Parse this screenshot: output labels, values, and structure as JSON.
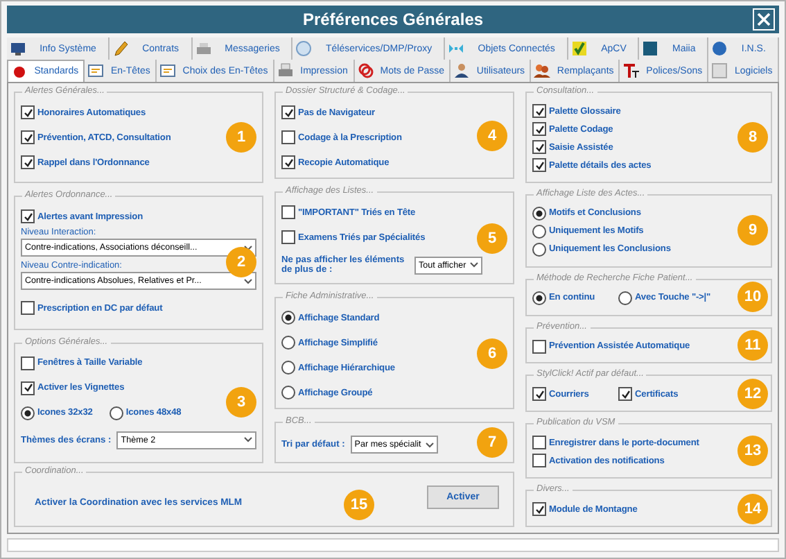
{
  "window": {
    "title": "Préférences Générales"
  },
  "tab_rows": [
    [
      {
        "label": "Info Système",
        "selected": false
      },
      {
        "label": "Contrats",
        "selected": false
      },
      {
        "label": "Messageries",
        "selected": false
      },
      {
        "label": "Téléservices/DMP/Proxy",
        "selected": false
      },
      {
        "label": "Objets Connectés",
        "selected": false
      },
      {
        "label": "ApCV",
        "selected": false
      },
      {
        "label": "Maiia",
        "selected": false
      },
      {
        "label": "I.N.S.",
        "selected": false
      }
    ],
    [
      {
        "label": "Standards",
        "selected": true
      },
      {
        "label": "En-Têtes",
        "selected": false
      },
      {
        "label": "Choix des En-Têtes",
        "selected": false
      },
      {
        "label": "Impression",
        "selected": false
      },
      {
        "label": "Mots de Passe",
        "selected": false
      },
      {
        "label": "Utilisateurs",
        "selected": false
      },
      {
        "label": "Remplaçants",
        "selected": false
      },
      {
        "label": "Polices/Sons",
        "selected": false
      },
      {
        "label": "Logiciels",
        "selected": false
      }
    ]
  ],
  "columns": [
    [
      {
        "title": "Alertes Générales...",
        "badge": "1",
        "items": [
          {
            "kind": "checkbox",
            "label": "Honoraires Automatiques",
            "checked": true
          },
          {
            "kind": "checkbox",
            "label": "Prévention, ATCD, Consultation",
            "checked": true
          },
          {
            "kind": "checkbox",
            "label": "Rappel dans l'Ordonnance",
            "checked": true
          }
        ]
      },
      {
        "title": "Alertes Ordonnance...",
        "badge": "2",
        "items": [
          {
            "kind": "checkbox",
            "label": "Alertes avant Impression",
            "checked": true
          },
          {
            "kind": "caption",
            "text": "Niveau Interaction:"
          },
          {
            "kind": "select",
            "value": "Contre-indications, Associations déconseill..."
          },
          {
            "kind": "caption",
            "text": "Niveau Contre-indication:"
          },
          {
            "kind": "select",
            "value": "Contre-indications Absolues, Relatives et Pr..."
          },
          {
            "kind": "checkbox",
            "label": "Prescription en DC par défaut",
            "checked": false
          }
        ]
      },
      {
        "title": "Options Générales...",
        "badge": "3",
        "items": [
          {
            "kind": "checkbox",
            "label": "Fenêtres à Taille Variable",
            "checked": false
          },
          {
            "kind": "checkbox",
            "label": "Activer les Vignettes",
            "checked": true
          },
          {
            "kind": "row",
            "items": [
              {
                "kind": "radio",
                "label": "Icones 32x32",
                "selected": true
              },
              {
                "kind": "radio",
                "label": "Icones 48x48",
                "selected": false
              }
            ]
          },
          {
            "kind": "select",
            "label": "Thèmes des écrans :",
            "value": "Thème 2"
          }
        ]
      }
    ],
    [
      {
        "title": "Dossier Structuré & Codage...",
        "badge": "4",
        "items": [
          {
            "kind": "checkbox",
            "label": "Pas de Navigateur",
            "checked": true
          },
          {
            "kind": "checkbox",
            "label": "Codage à la Prescription",
            "checked": false
          },
          {
            "kind": "checkbox",
            "label": "Recopie Automatique",
            "checked": true
          }
        ]
      },
      {
        "title": "Affichage des Listes...",
        "badge": "5",
        "items": [
          {
            "kind": "checkbox",
            "label": "\"IMPORTANT\" Triés en Tête",
            "checked": false
          },
          {
            "kind": "checkbox",
            "label": "Examens Triés par Spécialités",
            "checked": false
          },
          {
            "kind": "select",
            "label": "Ne pas afficher les éléments de plus de :",
            "value": "Tout afficher"
          }
        ]
      },
      {
        "title": "Fiche Administrative...",
        "badge": "6",
        "items": [
          {
            "kind": "radio",
            "label": "Affichage Standard",
            "selected": true
          },
          {
            "kind": "radio",
            "label": "Affichage Simplifié",
            "selected": false
          },
          {
            "kind": "radio",
            "label": "Affichage Hiérarchique",
            "selected": false
          },
          {
            "kind": "radio",
            "label": "Affichage Groupé",
            "selected": false
          }
        ]
      },
      {
        "title": "BCB...",
        "badge": "7",
        "items": [
          {
            "kind": "select",
            "label": "Tri par défaut :",
            "value": "Par mes spécialit"
          }
        ]
      }
    ],
    [
      {
        "title": "Consultation...",
        "badge": "8",
        "items": [
          {
            "kind": "checkbox",
            "label": "Palette Glossaire",
            "checked": true
          },
          {
            "kind": "checkbox",
            "label": "Palette Codage",
            "checked": true
          },
          {
            "kind": "checkbox",
            "label": "Saisie Assistée",
            "checked": true
          },
          {
            "kind": "checkbox",
            "label": "Palette détails des actes",
            "checked": true
          }
        ]
      },
      {
        "title": "Affichage Liste des Actes...",
        "badge": "9",
        "items": [
          {
            "kind": "radio",
            "label": "Motifs et Conclusions",
            "selected": true
          },
          {
            "kind": "radio",
            "label": "Uniquement les Motifs",
            "selected": false
          },
          {
            "kind": "radio",
            "label": "Uniquement les Conclusions",
            "selected": false
          }
        ]
      },
      {
        "title": "Méthode de Recherche Fiche Patient...",
        "badge": "10",
        "items": [
          {
            "kind": "row",
            "items": [
              {
                "kind": "radio",
                "label": "En continu",
                "selected": true
              },
              {
                "kind": "radio",
                "label": "Avec Touche \"->|\"",
                "selected": false
              }
            ]
          }
        ]
      },
      {
        "title": "Prévention...",
        "badge": "11",
        "items": [
          {
            "kind": "checkbox",
            "label": "Prévention Assistée Automatique",
            "checked": false
          }
        ]
      },
      {
        "title": "StylClick! Actif par défaut...",
        "badge": "12",
        "items": [
          {
            "kind": "row",
            "items": [
              {
                "kind": "checkbox",
                "label": "Courriers",
                "checked": true
              },
              {
                "kind": "checkbox",
                "label": "Certificats",
                "checked": true
              }
            ]
          }
        ]
      },
      {
        "title": "Publication du VSM",
        "badge": "13",
        "items": [
          {
            "kind": "checkbox",
            "label": "Enregistrer dans le porte-document",
            "checked": false
          },
          {
            "kind": "checkbox",
            "label": "Activation des notifications",
            "checked": false
          }
        ]
      },
      {
        "title": "Divers...",
        "badge": "14",
        "items": [
          {
            "kind": "checkbox",
            "label": "Module de Montagne",
            "checked": true
          }
        ]
      }
    ]
  ],
  "coordination": {
    "title": "Coordination...",
    "text": "Activer la Coordination avec les services MLM",
    "button": "Activer",
    "badge": "15"
  }
}
